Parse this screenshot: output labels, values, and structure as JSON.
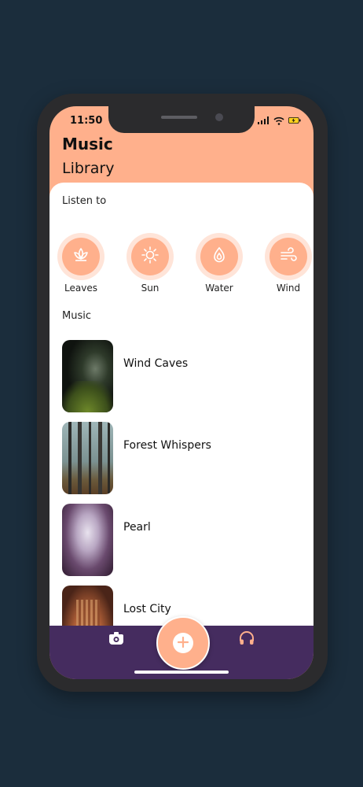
{
  "status_bar": {
    "time": "11:50"
  },
  "header": {
    "title": "Music",
    "subtitle": "Library"
  },
  "listen": {
    "label": "Listen to",
    "items": [
      {
        "label": "Leaves",
        "icon": "lotus-icon"
      },
      {
        "label": "Sun",
        "icon": "sun-icon"
      },
      {
        "label": "Water",
        "icon": "water-drop-icon"
      },
      {
        "label": "Wind",
        "icon": "wind-icon"
      }
    ]
  },
  "music": {
    "label": "Music",
    "items": [
      {
        "name": "Wind Caves"
      },
      {
        "name": "Forest Whispers"
      },
      {
        "name": "Pearl"
      },
      {
        "name": "Lost City"
      }
    ]
  },
  "colors": {
    "accent": "#ffb08c",
    "accent_light": "#ffe4d8",
    "nav_bg": "#452c5f",
    "page_bg": "#1b2d3c"
  },
  "nav": {
    "left_icon": "camera-icon",
    "center_icon": "plus-icon",
    "right_icon": "headphones-icon"
  }
}
